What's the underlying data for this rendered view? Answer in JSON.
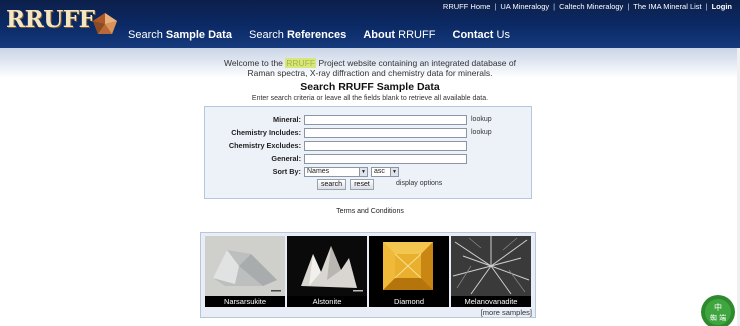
{
  "brand": {
    "logo_text": "RRUFF"
  },
  "toplinks": [
    "RRUFF Home",
    "UA Mineralogy",
    "Caltech Mineralogy",
    "The IMA Mineral List"
  ],
  "login_label": "Login",
  "nav": [
    {
      "plain": "Search ",
      "bold": "Sample Data"
    },
    {
      "plain": "Search ",
      "bold": "References"
    },
    {
      "plain": "About ",
      "bold": "RRUFF",
      "bold_first": true
    },
    {
      "plain": "Contact ",
      "bold": "Us",
      "bold_first": true
    }
  ],
  "welcome": {
    "pre": "Welcome to the ",
    "highlight": "RRUFF",
    "post": " Project website containing an integrated database of",
    "line2": "Raman spectra, X-ray diffraction and chemistry data for minerals."
  },
  "page_title": "Search RRUFF Sample Data",
  "subtitle": "Enter search criteria or leave all the fields blank to retrieve all available data.",
  "form": {
    "mineral_label": "Mineral:",
    "mineral_value": "",
    "chem_includes_label": "Chemistry Includes:",
    "chem_includes_value": "",
    "chem_excludes_label": "Chemistry Excludes:",
    "chem_excludes_value": "",
    "general_label": "General:",
    "general_value": "",
    "lookup_label": "lookup",
    "sort_label": "Sort By:",
    "sort_value": "Names",
    "order_value": "asc",
    "search_label": "search",
    "reset_label": "reset",
    "display_options_label": "display options"
  },
  "terms_label": "Terms and Conditions",
  "samples": [
    {
      "name": "Narsarsukite"
    },
    {
      "name": "Alstonite"
    },
    {
      "name": "Diamond"
    },
    {
      "name": "Melanovanadite"
    }
  ],
  "more_samples_label": "[more samples]",
  "badge": {
    "text_top": "中",
    "text_bottom": "蜘 端"
  }
}
